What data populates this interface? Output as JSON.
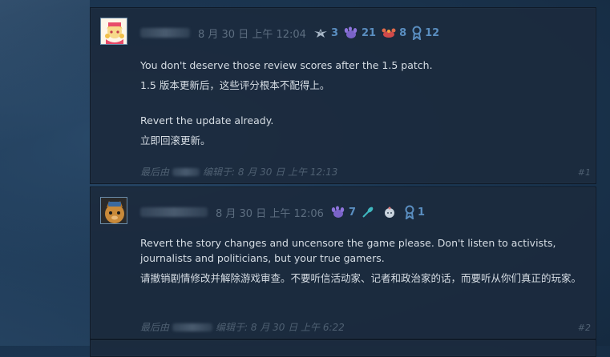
{
  "posts": [
    {
      "timestamp": "8 月 30 日 上午 12:04",
      "badges": [
        {
          "icon": "bird-icon",
          "count": "3"
        },
        {
          "icon": "paw-icon",
          "count": "21"
        },
        {
          "icon": "crab-icon",
          "count": "8"
        },
        {
          "icon": "ribbon-icon",
          "count": "12"
        }
      ],
      "paragraphs": [
        "You don't deserve those review scores after the 1.5 patch.",
        "1.5 版本更新后，这些评分根本不配得上。",
        "",
        "Revert the update already.",
        "立即回滚更新。"
      ],
      "footer_prefix": "最后由",
      "footer_suffix": "编辑于: 8 月 30 日 上午 12:13",
      "number": "#1"
    },
    {
      "timestamp": "8 月 30 日 上午 12:06",
      "badges": [
        {
          "icon": "paw-icon",
          "count": "7"
        },
        {
          "icon": "feather-icon",
          "count": ""
        },
        {
          "icon": "baby-icon",
          "count": ""
        },
        {
          "icon": "ribbon-icon",
          "count": "1"
        }
      ],
      "paragraphs": [
        "Revert the story changes and uncensore the game please. Don't listen to activists, journalists and politicians, but your true gamers.",
        "请撤销剧情修改并解除游戏审查。不要听信活动家、记者和政治家的话，而要听从你们真正的玩家。"
      ],
      "footer_prefix": "最后由",
      "footer_suffix": "编辑于: 8 月 30 日 上午 6:22",
      "number": "#2"
    }
  ],
  "colors": {
    "badge_count": "#5a8ec0",
    "timestamp": "#5d6e80",
    "body_text": "#d6dde4",
    "panel": "#1c2a3e"
  }
}
